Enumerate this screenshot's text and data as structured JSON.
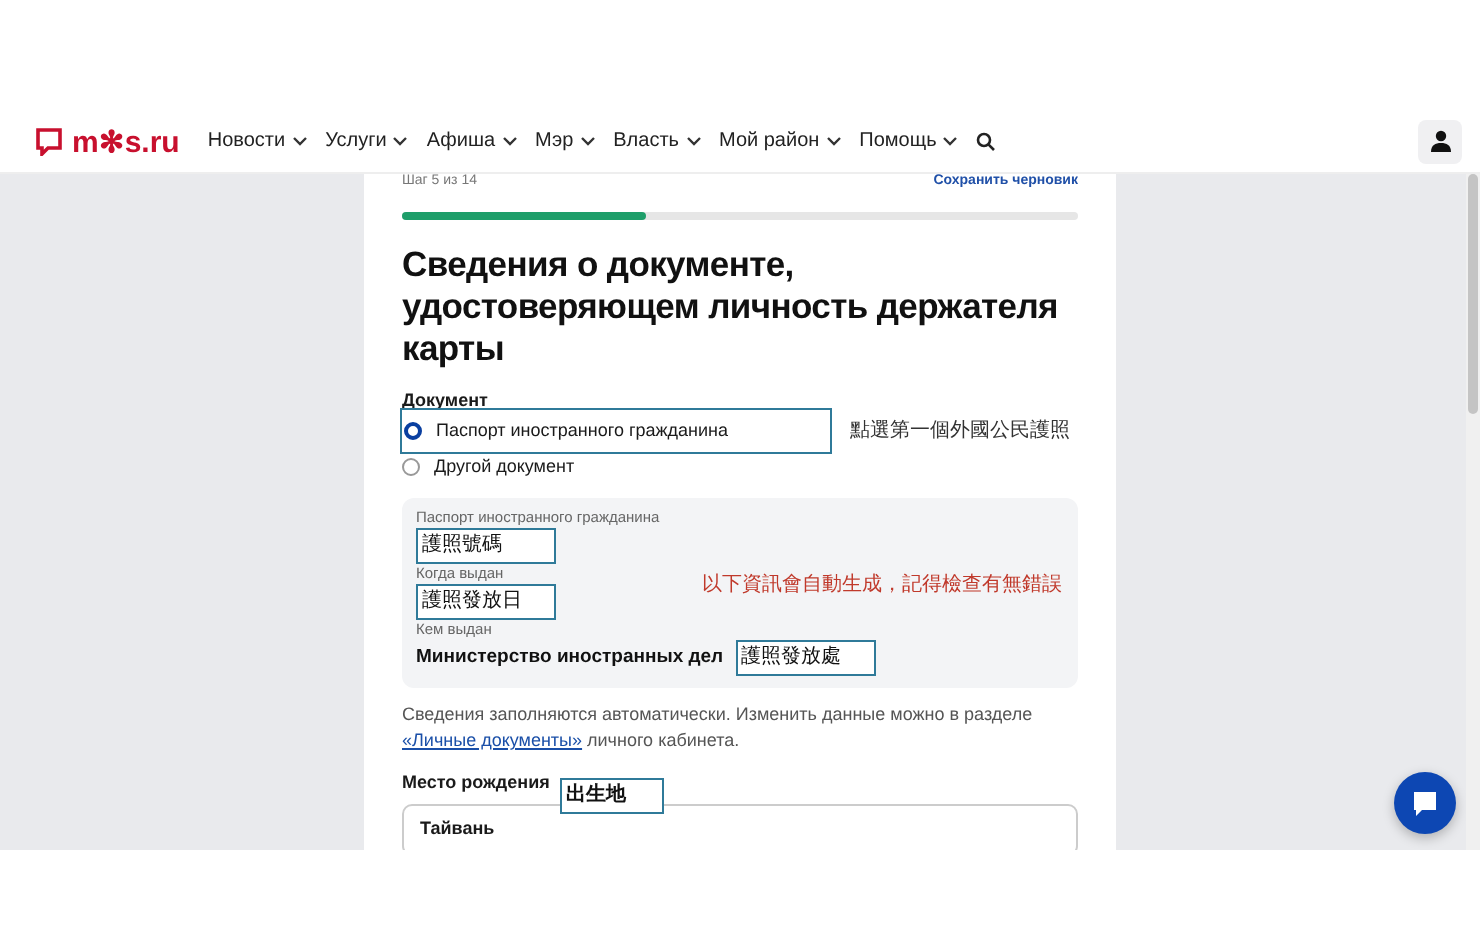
{
  "header": {
    "logo": "m✻s.ru",
    "nav": [
      {
        "label": "Новости"
      },
      {
        "label": "Услуги"
      },
      {
        "label": "Афиша"
      },
      {
        "label": "Мэр"
      },
      {
        "label": "Власть"
      },
      {
        "label": "Мой район"
      },
      {
        "label": "Помощь"
      }
    ]
  },
  "form": {
    "step": "Шаг 5 из 14",
    "save_draft": "Сохранить черновик",
    "progress": {
      "level": 0.36
    },
    "title": "Сведения о документе, удостоверяющем личность держателя карты",
    "document_label": "Документ",
    "options": [
      {
        "label": "Паспорт иностранного гражданина",
        "selected": true,
        "annotation": "點選第一個外國公民護照"
      },
      {
        "label": "Другой документ",
        "selected": false
      }
    ],
    "panel": {
      "note": "以下資訊會自動生成，記得檢查有無錯誤",
      "fields": [
        {
          "label": "Паспорт иностранного гражданина",
          "annotation": "護照號碼"
        },
        {
          "label": "Когда выдан",
          "annotation": "護照發放日"
        },
        {
          "label": "Кем выдан",
          "value": "Министерство иностранных дел",
          "annotation": "護照發放處"
        }
      ]
    },
    "info": {
      "before": "Сведения заполняются автоматически. Изменить данные можно в разделе ",
      "link": "«Личные документы»",
      "after": " личного кабинета."
    },
    "birthplace": {
      "label": "Место рождения",
      "value": "Тайвань",
      "annotation": "出生地"
    }
  }
}
